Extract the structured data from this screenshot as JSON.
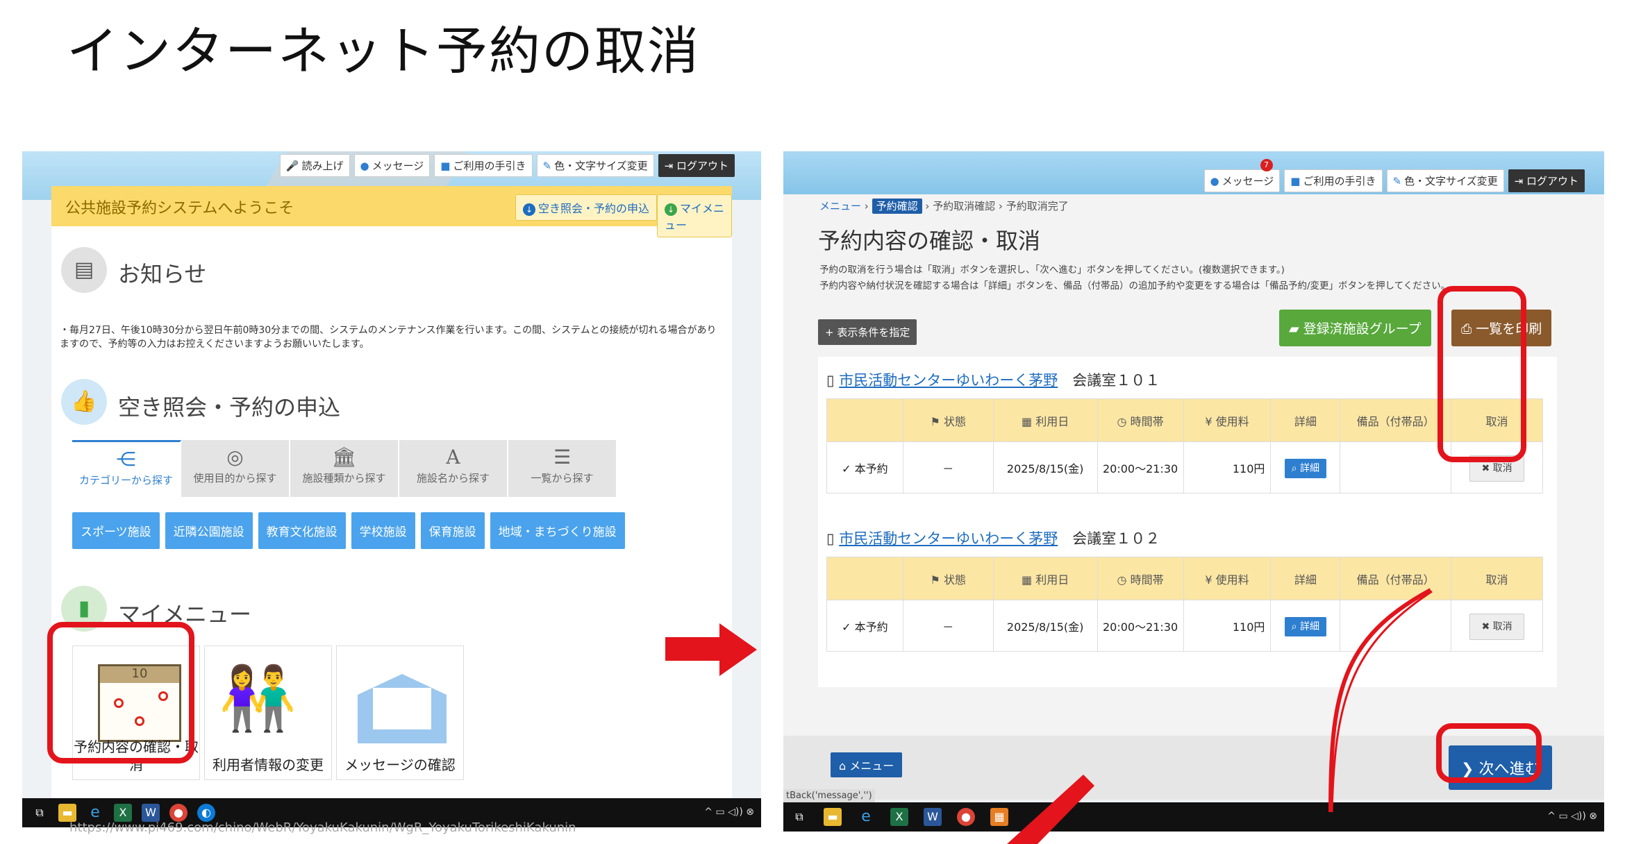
{
  "slide_title": "インターネット予約の取消",
  "left": {
    "toplinks": [
      {
        "icon": "microphone-icon",
        "label": "読み上げ"
      },
      {
        "icon": "message-icon",
        "label": "メッセージ"
      },
      {
        "icon": "book-icon",
        "label": "ご利用の手引き"
      },
      {
        "icon": "pen-icon",
        "label": "色・文字サイズ変更"
      },
      {
        "icon": "logout-icon",
        "label": "ログアウト"
      }
    ],
    "welcome": "公共施設予約システムへようこそ",
    "welcome_buttons": [
      "空き照会・予約の申込",
      "マイメニュー"
    ],
    "notice_title": "お知らせ",
    "notice_text": "・毎月27日、午後10時30分から翌日午前0時30分までの間、システムのメンテナンス作業を行います。この間、システムとの接続が切れる場合がありますので、予約等の入力はお控えくださいますようお願いいたします。",
    "search_title": "空き照会・予約の申込",
    "tabs": [
      {
        "icon": "share-icon",
        "label": "カテゴリーから探す"
      },
      {
        "icon": "compass-icon",
        "label": "使用目的から探す"
      },
      {
        "icon": "building-icon",
        "label": "施設種類から探す"
      },
      {
        "icon": "letter-a-icon",
        "label": "施設名から探す"
      },
      {
        "icon": "list-icon",
        "label": "一覧から探す"
      }
    ],
    "categories": [
      "スポーツ施設",
      "近隣公園施設",
      "教育文化施設",
      "学校施設",
      "保育施設",
      "地域・まちづくり施設"
    ],
    "mymenu_title": "マイメニュー",
    "tiles": [
      "予約内容の確認・取消",
      "利用者情報の変更",
      "メッセージの確認"
    ],
    "calendar_number": "10",
    "url": "https://www.pi469.com/chino/WebR/YoyakuKakunin/WgR_YoyakuTorikeshiKakunin"
  },
  "right": {
    "toplinks": [
      {
        "icon": "message-icon",
        "label": "メッセージ"
      },
      {
        "icon": "book-icon",
        "label": "ご利用の手引き"
      },
      {
        "icon": "pen-icon",
        "label": "色・文字サイズ変更"
      },
      {
        "icon": "logout-icon",
        "label": "ログアウト"
      }
    ],
    "message_count": "7",
    "breadcrumb": [
      "メニュー",
      "予約確認",
      "予約取消確認",
      "予約取消完了"
    ],
    "title": "予約内容の確認・取消",
    "help_lines": [
      "予約の取消を行う場合は「取消」ボタンを選択し、「次へ進む」ボタンを押してください。(複数選択できます。)",
      "予約内容や納付状況を確認する場合は「詳細」ボタンを、備品（付帯品）の追加予約や変更をする場合は「備品予約/変更」ボタンを押してください。"
    ],
    "btn_condition": "表示条件を指定",
    "btn_group": "登録済施設グループ",
    "btn_print": "一覧を印刷",
    "columns": [
      "",
      "状態",
      "利用日",
      "時間帯",
      "使用料",
      "詳細",
      "備品（付帯品）",
      "取消"
    ],
    "reservations": [
      {
        "facility": "市民活動センターゆいわーく茅野",
        "room": "会議室１０１",
        "type": "本予約",
        "status": "－",
        "date": "2025/8/15(金)",
        "time": "20:00～21:30",
        "fee": "110円",
        "detail": "詳細",
        "cancel": "取消"
      },
      {
        "facility": "市民活動センターゆいわーく茅野",
        "room": "会議室１０２",
        "type": "本予約",
        "status": "－",
        "date": "2025/8/15(金)",
        "time": "20:00～21:30",
        "fee": "110円",
        "detail": "詳細",
        "cancel": "取消"
      }
    ],
    "btn_menu": "メニュー",
    "btn_next": "次へ進む",
    "status_text": "tBack('message','')"
  }
}
